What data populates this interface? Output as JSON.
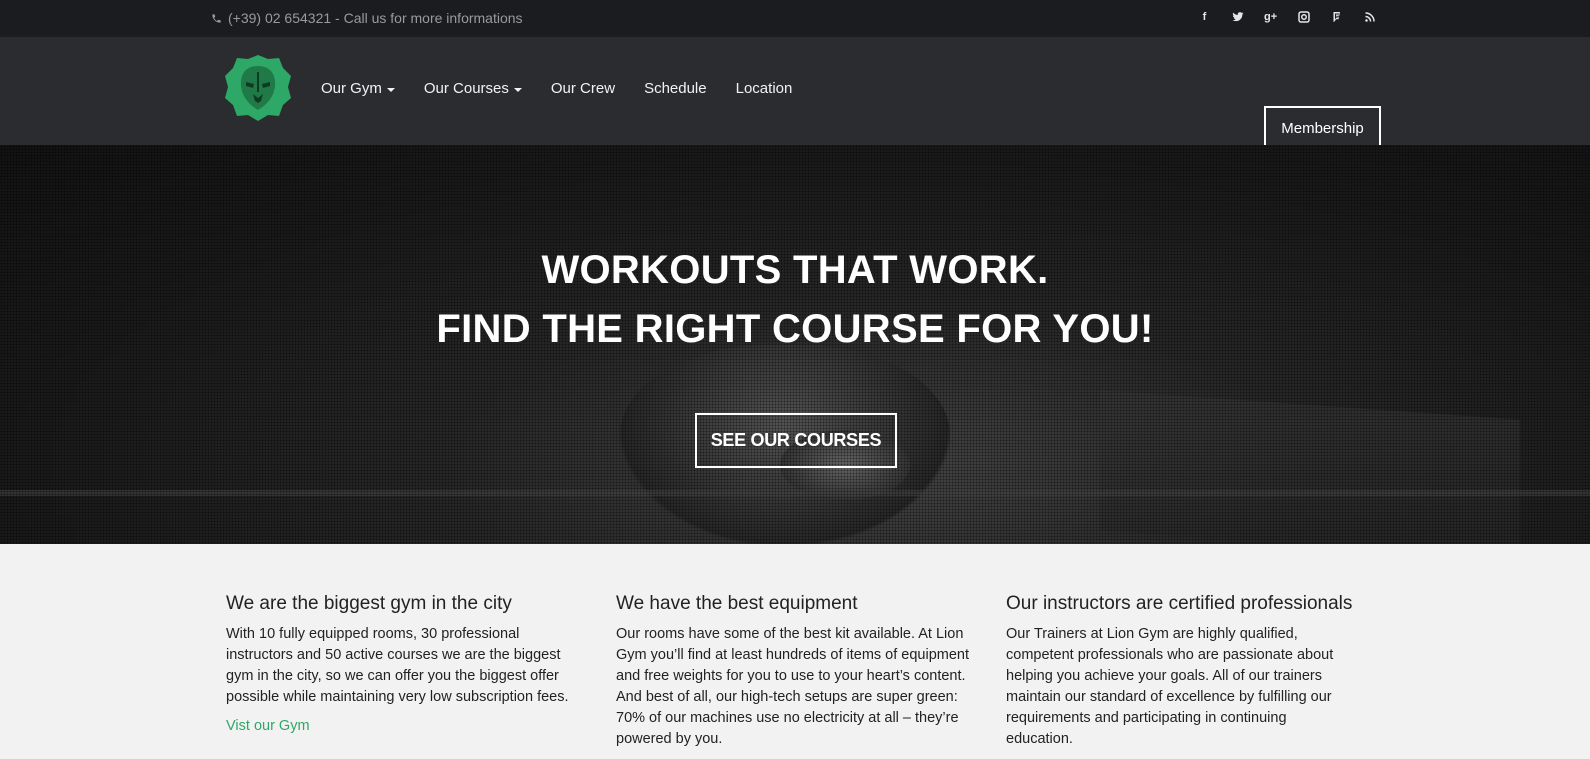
{
  "topbar": {
    "phone_icon": "phone-icon",
    "phone_text": "(+39) 02 654321 - Call us for more informations",
    "social_icons": [
      "facebook-icon",
      "twitter-icon",
      "google-plus-icon",
      "instagram-icon",
      "foursquare-icon",
      "rss-icon"
    ]
  },
  "navbar": {
    "logo": "lion-logo-icon",
    "logo_color": "#2ea866",
    "items": [
      {
        "label": "Our Gym",
        "dropdown": true
      },
      {
        "label": "Our Courses",
        "dropdown": true
      },
      {
        "label": "Our Crew",
        "dropdown": false
      },
      {
        "label": "Schedule",
        "dropdown": false
      },
      {
        "label": "Location",
        "dropdown": false
      }
    ],
    "membership_label": "Membership"
  },
  "hero": {
    "title_line1": "WORKOUTS THAT WORK.",
    "title_line2": "FIND THE RIGHT COURSE FOR YOU!",
    "cta_label": "SEE OUR COURSES"
  },
  "features": [
    {
      "title": "We are the biggest gym in the city",
      "text": "With 10 fully equipped rooms, 30 professional instructors and 50 active courses we are the biggest gym in the city, so we can offer you the biggest offer possible while maintaining very low subscription fees.",
      "link": "Vist our Gym"
    },
    {
      "title": "We have the best equipment",
      "text": "Our rooms have some of the best kit available. At Lion Gym you’ll find at least hundreds of items of equipment and free weights for you to use to your heart’s content. And best of all, our high-tech setups are super green: 70% of our machines use no electricity at all – they’re powered by you."
    },
    {
      "title": "Our instructors are certified professionals",
      "text": "Our Trainers at Lion Gym are highly qualified, competent professionals who are passionate about helping you achieve your goals. All of our trainers maintain our standard of excellence by fulfilling our requirements and participating in continuing education."
    }
  ],
  "colors": {
    "accent": "#2ea866",
    "topbar_bg": "#1b1c20",
    "navbar_bg": "#2b2c30",
    "page_bg": "#f2f2f2"
  }
}
